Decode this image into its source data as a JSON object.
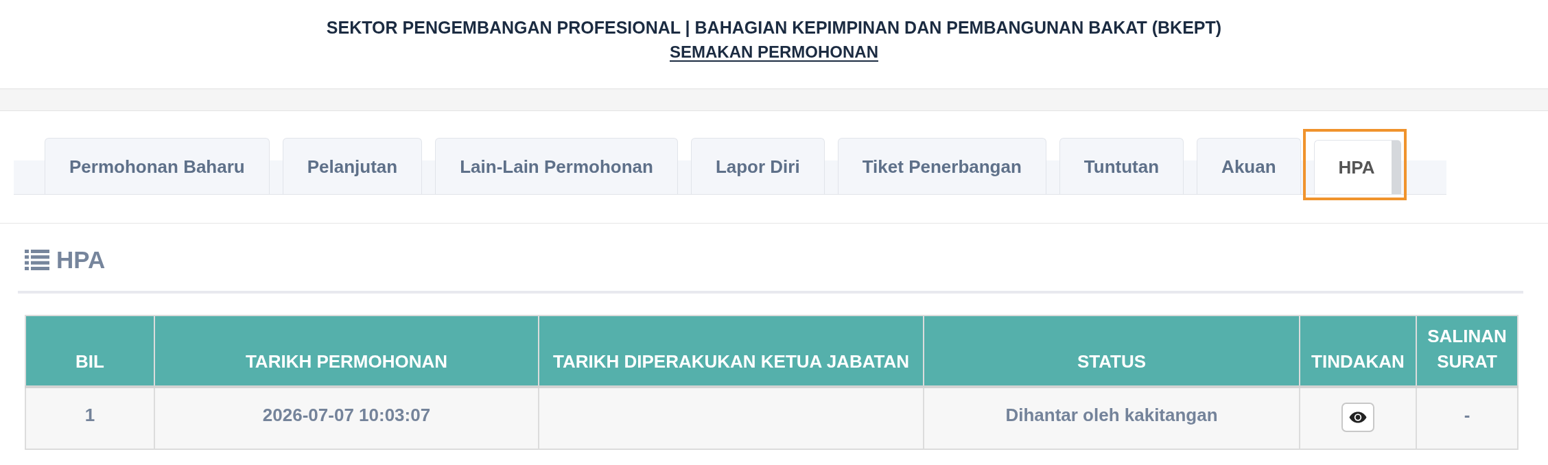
{
  "header": {
    "title": "SEKTOR PENGEMBANGAN PROFESIONAL | BAHAGIAN KEPIMPINAN DAN PEMBANGUNAN BAKAT (BKEPT)",
    "subtitle": "SEMAKAN PERMOHONAN"
  },
  "tabs": [
    {
      "label": "Permohonan Baharu",
      "selected": false
    },
    {
      "label": "Pelanjutan",
      "selected": false
    },
    {
      "label": "Lain-Lain Permohonan",
      "selected": false
    },
    {
      "label": "Lapor Diri",
      "selected": false
    },
    {
      "label": "Tiket Penerbangan",
      "selected": false
    },
    {
      "label": "Tuntutan",
      "selected": false
    },
    {
      "label": "Akuan",
      "selected": false
    },
    {
      "label": "HPA",
      "selected": true
    }
  ],
  "section": {
    "title": "HPA"
  },
  "table": {
    "columns": [
      "BIL",
      "TARIKH PERMOHONAN",
      "TARIKH DIPERAKUKAN KETUA JABATAN",
      "STATUS",
      "TINDAKAN",
      "SALINAN SURAT"
    ],
    "rows": [
      {
        "cells": [
          {
            "kind": "text",
            "text": "1"
          },
          {
            "kind": "text",
            "text": "2026-07-07 10:03:07"
          },
          {
            "kind": "empty"
          },
          {
            "kind": "text",
            "text": "Dihantar oleh kakitangan"
          },
          {
            "kind": "view_button"
          },
          {
            "kind": "text",
            "text": "-"
          }
        ]
      }
    ]
  }
}
